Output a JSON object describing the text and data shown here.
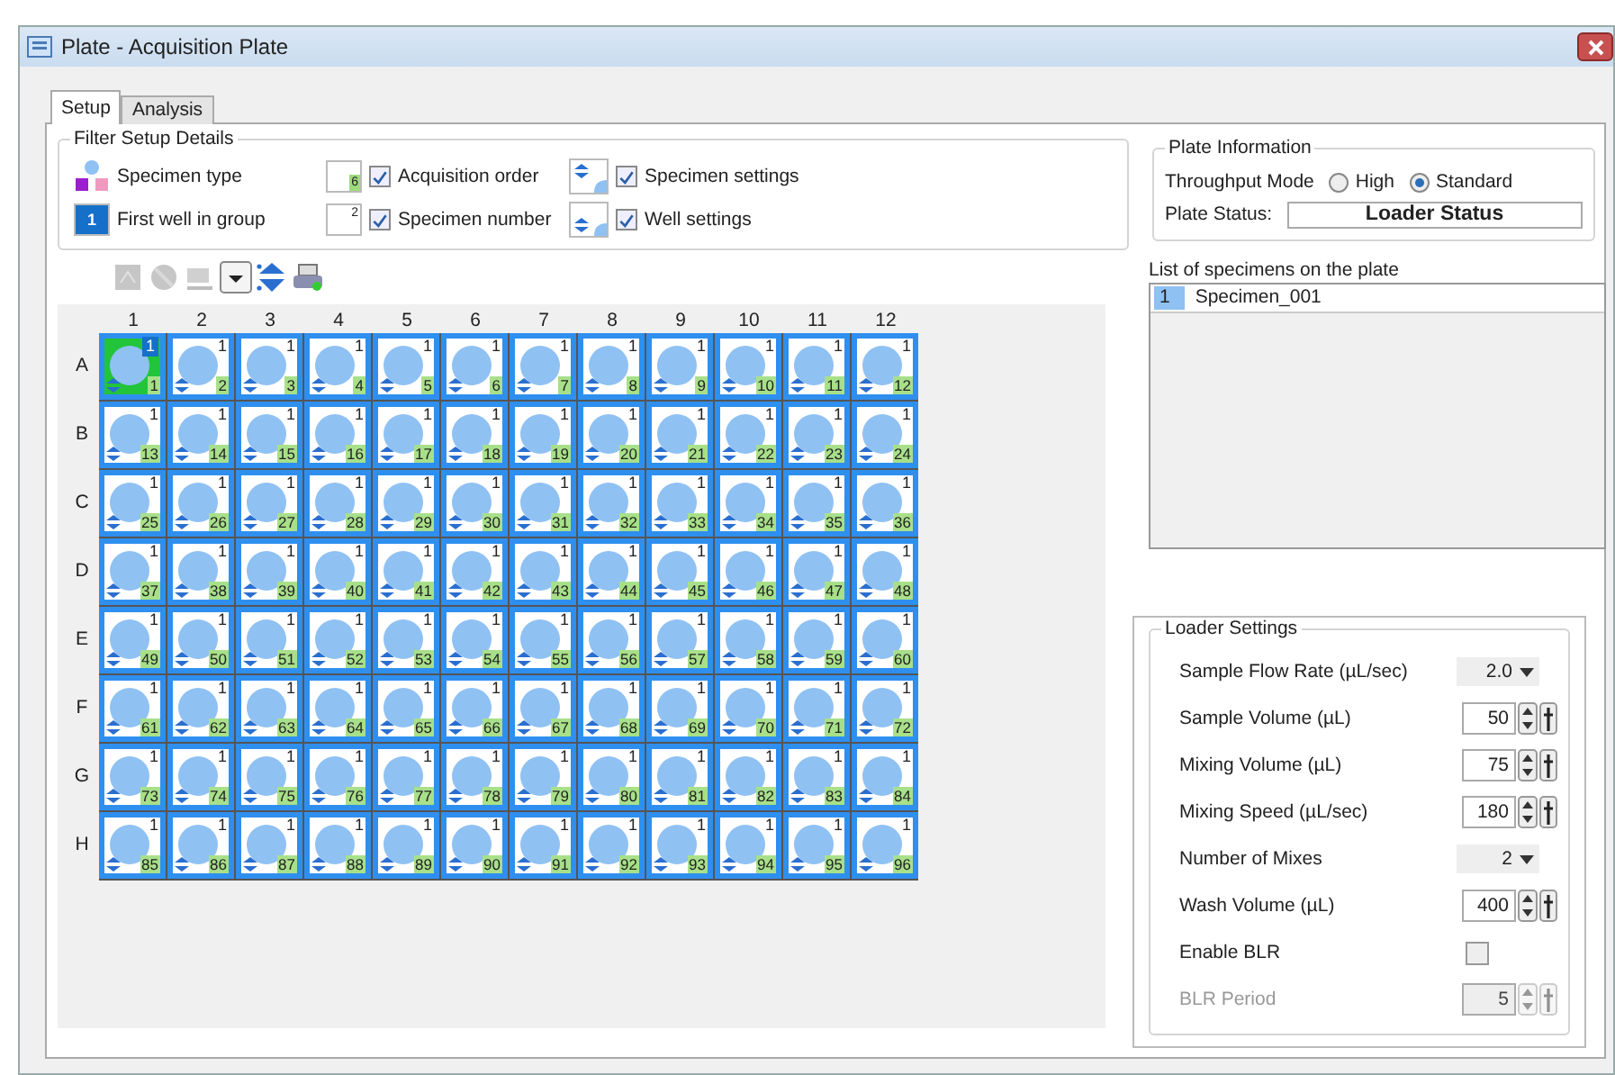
{
  "window": {
    "title": "Plate - Acquisition Plate"
  },
  "tabs": [
    {
      "label": "Setup",
      "selected": true
    },
    {
      "label": "Analysis",
      "selected": false
    }
  ],
  "filter_setup": {
    "title": "Filter Setup Details",
    "items": [
      {
        "kind": "legend",
        "label": "Specimen type"
      },
      {
        "kind": "checkbox",
        "icon_text": "6",
        "label": "Acquisition order",
        "checked": true
      },
      {
        "kind": "checkbox",
        "label": "Specimen settings",
        "checked": true
      },
      {
        "kind": "legend",
        "icon_text": "1",
        "label": "First well in group"
      },
      {
        "kind": "checkbox",
        "icon_text": "2",
        "label": "Specimen number",
        "checked": true
      },
      {
        "kind": "checkbox",
        "label": "Well settings",
        "checked": true
      }
    ]
  },
  "toolbar": [
    {
      "disabled": true
    },
    {
      "disabled": true
    },
    {
      "disabled": true
    },
    {
      "disabled": false
    },
    {
      "disabled": false
    },
    {
      "disabled": false
    }
  ],
  "plate": {
    "columns": [
      "1",
      "2",
      "3",
      "4",
      "5",
      "6",
      "7",
      "8",
      "9",
      "10",
      "11",
      "12"
    ],
    "rows": [
      {
        "label": "A",
        "wells": [
          {
            "specimen": "1",
            "order": "1",
            "selected": true
          },
          {
            "specimen": "1",
            "order": "2",
            "selected": false
          },
          {
            "specimen": "1",
            "order": "3",
            "selected": false
          },
          {
            "specimen": "1",
            "order": "4",
            "selected": false
          },
          {
            "specimen": "1",
            "order": "5",
            "selected": false
          },
          {
            "specimen": "1",
            "order": "6",
            "selected": false
          },
          {
            "specimen": "1",
            "order": "7",
            "selected": false
          },
          {
            "specimen": "1",
            "order": "8",
            "selected": false
          },
          {
            "specimen": "1",
            "order": "9",
            "selected": false
          },
          {
            "specimen": "1",
            "order": "10",
            "selected": false
          },
          {
            "specimen": "1",
            "order": "11",
            "selected": false
          },
          {
            "specimen": "1",
            "order": "12",
            "selected": false
          }
        ]
      },
      {
        "label": "B",
        "wells": [
          {
            "specimen": "1",
            "order": "13",
            "selected": false
          },
          {
            "specimen": "1",
            "order": "14",
            "selected": false
          },
          {
            "specimen": "1",
            "order": "15",
            "selected": false
          },
          {
            "specimen": "1",
            "order": "16",
            "selected": false
          },
          {
            "specimen": "1",
            "order": "17",
            "selected": false
          },
          {
            "specimen": "1",
            "order": "18",
            "selected": false
          },
          {
            "specimen": "1",
            "order": "19",
            "selected": false
          },
          {
            "specimen": "1",
            "order": "20",
            "selected": false
          },
          {
            "specimen": "1",
            "order": "21",
            "selected": false
          },
          {
            "specimen": "1",
            "order": "22",
            "selected": false
          },
          {
            "specimen": "1",
            "order": "23",
            "selected": false
          },
          {
            "specimen": "1",
            "order": "24",
            "selected": false
          }
        ]
      },
      {
        "label": "C",
        "wells": [
          {
            "specimen": "1",
            "order": "25",
            "selected": false
          },
          {
            "specimen": "1",
            "order": "26",
            "selected": false
          },
          {
            "specimen": "1",
            "order": "27",
            "selected": false
          },
          {
            "specimen": "1",
            "order": "28",
            "selected": false
          },
          {
            "specimen": "1",
            "order": "29",
            "selected": false
          },
          {
            "specimen": "1",
            "order": "30",
            "selected": false
          },
          {
            "specimen": "1",
            "order": "31",
            "selected": false
          },
          {
            "specimen": "1",
            "order": "32",
            "selected": false
          },
          {
            "specimen": "1",
            "order": "33",
            "selected": false
          },
          {
            "specimen": "1",
            "order": "34",
            "selected": false
          },
          {
            "specimen": "1",
            "order": "35",
            "selected": false
          },
          {
            "specimen": "1",
            "order": "36",
            "selected": false
          }
        ]
      },
      {
        "label": "D",
        "wells": [
          {
            "specimen": "1",
            "order": "37",
            "selected": false
          },
          {
            "specimen": "1",
            "order": "38",
            "selected": false
          },
          {
            "specimen": "1",
            "order": "39",
            "selected": false
          },
          {
            "specimen": "1",
            "order": "40",
            "selected": false
          },
          {
            "specimen": "1",
            "order": "41",
            "selected": false
          },
          {
            "specimen": "1",
            "order": "42",
            "selected": false
          },
          {
            "specimen": "1",
            "order": "43",
            "selected": false
          },
          {
            "specimen": "1",
            "order": "44",
            "selected": false
          },
          {
            "specimen": "1",
            "order": "45",
            "selected": false
          },
          {
            "specimen": "1",
            "order": "46",
            "selected": false
          },
          {
            "specimen": "1",
            "order": "47",
            "selected": false
          },
          {
            "specimen": "1",
            "order": "48",
            "selected": false
          }
        ]
      },
      {
        "label": "E",
        "wells": [
          {
            "specimen": "1",
            "order": "49",
            "selected": false
          },
          {
            "specimen": "1",
            "order": "50",
            "selected": false
          },
          {
            "specimen": "1",
            "order": "51",
            "selected": false
          },
          {
            "specimen": "1",
            "order": "52",
            "selected": false
          },
          {
            "specimen": "1",
            "order": "53",
            "selected": false
          },
          {
            "specimen": "1",
            "order": "54",
            "selected": false
          },
          {
            "specimen": "1",
            "order": "55",
            "selected": false
          },
          {
            "specimen": "1",
            "order": "56",
            "selected": false
          },
          {
            "specimen": "1",
            "order": "57",
            "selected": false
          },
          {
            "specimen": "1",
            "order": "58",
            "selected": false
          },
          {
            "specimen": "1",
            "order": "59",
            "selected": false
          },
          {
            "specimen": "1",
            "order": "60",
            "selected": false
          }
        ]
      },
      {
        "label": "F",
        "wells": [
          {
            "specimen": "1",
            "order": "61",
            "selected": false
          },
          {
            "specimen": "1",
            "order": "62",
            "selected": false
          },
          {
            "specimen": "1",
            "order": "63",
            "selected": false
          },
          {
            "specimen": "1",
            "order": "64",
            "selected": false
          },
          {
            "specimen": "1",
            "order": "65",
            "selected": false
          },
          {
            "specimen": "1",
            "order": "66",
            "selected": false
          },
          {
            "specimen": "1",
            "order": "67",
            "selected": false
          },
          {
            "specimen": "1",
            "order": "68",
            "selected": false
          },
          {
            "specimen": "1",
            "order": "69",
            "selected": false
          },
          {
            "specimen": "1",
            "order": "70",
            "selected": false
          },
          {
            "specimen": "1",
            "order": "71",
            "selected": false
          },
          {
            "specimen": "1",
            "order": "72",
            "selected": false
          }
        ]
      },
      {
        "label": "G",
        "wells": [
          {
            "specimen": "1",
            "order": "73",
            "selected": false
          },
          {
            "specimen": "1",
            "order": "74",
            "selected": false
          },
          {
            "specimen": "1",
            "order": "75",
            "selected": false
          },
          {
            "specimen": "1",
            "order": "76",
            "selected": false
          },
          {
            "specimen": "1",
            "order": "77",
            "selected": false
          },
          {
            "specimen": "1",
            "order": "78",
            "selected": false
          },
          {
            "specimen": "1",
            "order": "79",
            "selected": false
          },
          {
            "specimen": "1",
            "order": "80",
            "selected": false
          },
          {
            "specimen": "1",
            "order": "81",
            "selected": false
          },
          {
            "specimen": "1",
            "order": "82",
            "selected": false
          },
          {
            "specimen": "1",
            "order": "83",
            "selected": false
          },
          {
            "specimen": "1",
            "order": "84",
            "selected": false
          }
        ]
      },
      {
        "label": "H",
        "wells": [
          {
            "specimen": "1",
            "order": "85",
            "selected": false
          },
          {
            "specimen": "1",
            "order": "86",
            "selected": false
          },
          {
            "specimen": "1",
            "order": "87",
            "selected": false
          },
          {
            "specimen": "1",
            "order": "88",
            "selected": false
          },
          {
            "specimen": "1",
            "order": "89",
            "selected": false
          },
          {
            "specimen": "1",
            "order": "90",
            "selected": false
          },
          {
            "specimen": "1",
            "order": "91",
            "selected": false
          },
          {
            "specimen": "1",
            "order": "92",
            "selected": false
          },
          {
            "specimen": "1",
            "order": "93",
            "selected": false
          },
          {
            "specimen": "1",
            "order": "94",
            "selected": false
          },
          {
            "specimen": "1",
            "order": "95",
            "selected": false
          },
          {
            "specimen": "1",
            "order": "96",
            "selected": false
          }
        ]
      }
    ]
  },
  "plate_information": {
    "title": "Plate Information",
    "throughput_label": "Throughput Mode",
    "modes": [
      {
        "label": "High",
        "selected": false
      },
      {
        "label": "Standard",
        "selected": true
      }
    ],
    "status_label": "Plate Status:",
    "status_value": "Loader Status"
  },
  "specimen_list": {
    "label": "List of specimens on the plate",
    "items": [
      {
        "number": "1",
        "name": "Specimen_001",
        "selected": false
      }
    ]
  },
  "loader_settings": {
    "title": "Loader Settings",
    "rows": [
      {
        "kind": "dropdown",
        "label": "Sample Flow Rate (µL/sec)",
        "value": "2.0",
        "disabled": false
      },
      {
        "kind": "spinner",
        "label": "Sample Volume (µL)",
        "value": "50",
        "disabled": false
      },
      {
        "kind": "spinner",
        "label": "Mixing Volume (µL)",
        "value": "75",
        "disabled": false
      },
      {
        "kind": "spinner",
        "label": "Mixing Speed (µL/sec)",
        "value": "180",
        "disabled": false
      },
      {
        "kind": "dropdown",
        "label": "Number of Mixes",
        "value": "2",
        "disabled": false
      },
      {
        "kind": "spinner",
        "label": "Wash Volume (µL)",
        "value": "400",
        "disabled": false
      },
      {
        "kind": "checkbox",
        "label": "Enable BLR",
        "checked": false,
        "disabled": false
      },
      {
        "kind": "spinner",
        "label": "BLR Period",
        "value": "5",
        "disabled": true
      }
    ]
  }
}
